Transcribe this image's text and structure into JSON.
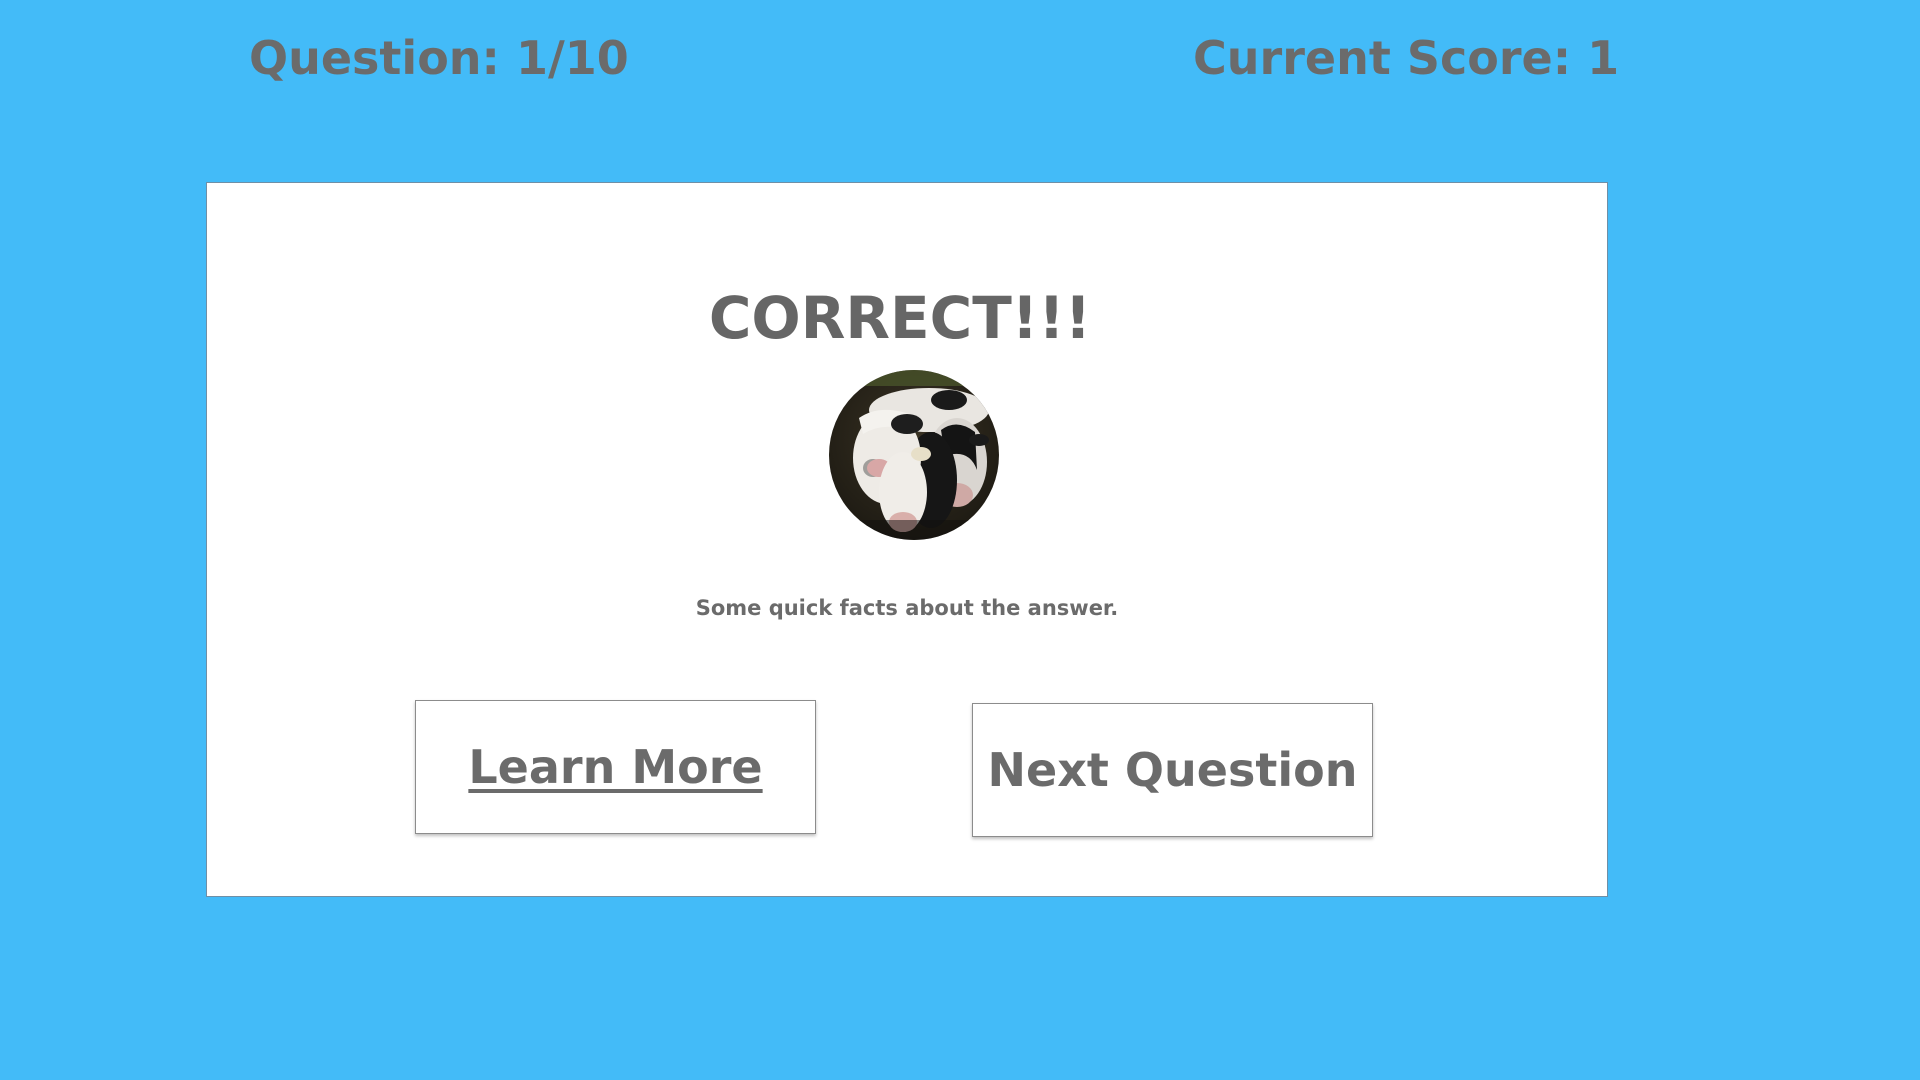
{
  "header": {
    "question_counter": "Question: 1/10",
    "current_score": "Current Score: 1"
  },
  "result": {
    "title": "CORRECT!!!",
    "image_subject": "cows",
    "facts_text": "Some quick facts about the answer."
  },
  "buttons": {
    "learn_more_label": "Learn More",
    "next_question_label": "Next Question"
  },
  "colors": {
    "background": "#43bbf8",
    "card": "#ffffff",
    "text": "#6b6b6b"
  }
}
